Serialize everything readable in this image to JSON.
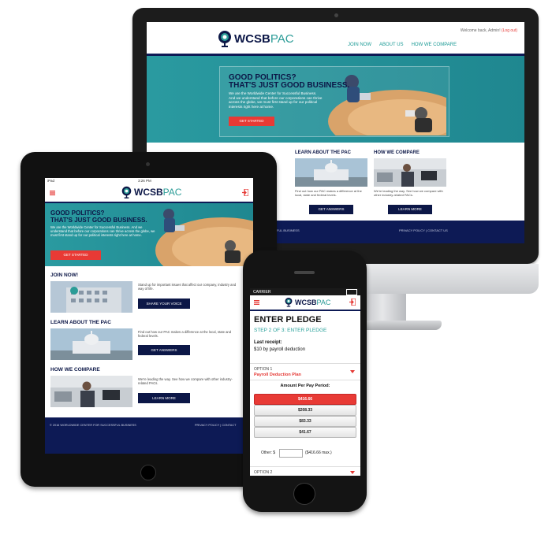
{
  "desktop": {
    "welcome_prefix": "Welcome back, Admin!",
    "logout": "(Log out)",
    "logo": {
      "bold": "WCSB",
      "light": "PAC"
    },
    "nav": [
      "JOIN NOW",
      "ABOUT US",
      "HOW WE COMPARE"
    ],
    "hero": {
      "title": "GOOD POLITICS?\nTHAT'S JUST GOOD BUSINESS.",
      "text": "We are the Worldwide Center for Successful Business. And we understand that before our corporations can thrive across the globe, we must first stand up for our political interests right here at home.",
      "cta": "GET STARTED"
    },
    "columns": [
      {
        "title": "LEARN ABOUT THE PAC",
        "text": "Find out how our PAC makes a difference at the local, state and federal levels.",
        "button": "GET ANSWERS"
      },
      {
        "title": "HOW WE COMPARE",
        "text": "We're leading the way. See how we compare with other industry-related PACs.",
        "button": "LEARN MORE"
      }
    ],
    "footer_left": "…CESSFUL BUSINESS",
    "footer_right": "PRIVACY POLICY | CONTACT US"
  },
  "tablet": {
    "status_left": "iPad",
    "status_center": "3:26 PM",
    "logo": {
      "bold": "WCSB",
      "light": "PAC"
    },
    "hero": {
      "title": "GOOD POLITICS?\nTHAT'S JUST GOOD BUSINESS.",
      "text": "We are the Worldwide Center for Successful Business. And we understand that before our corporations can thrive across the globe, we must first stand up for our political interests right here at home.",
      "cta": "GET STARTED"
    },
    "sections": [
      {
        "title": "JOIN NOW!",
        "text": "Stand up for important issues that affect our company, industry and way of life.",
        "button": "SHARE YOUR VOICE"
      },
      {
        "title": "LEARN ABOUT THE PAC",
        "text": "Find out how our PAC makes a difference at the local, state and federal levels.",
        "button": "GET ANSWERS"
      },
      {
        "title": "HOW WE COMPARE",
        "text": "We're leading the way. See how we compare with other industry-related PACs.",
        "button": "LEARN MORE"
      }
    ],
    "footer_left": "© 2016 WORLDWIDE CENTER FOR SUCCESSFUL BUSINESS",
    "footer_right": "PRIVACY POLICY | CONTACT"
  },
  "phone": {
    "carrier": "CARRIER",
    "logo": {
      "bold": "WCSB",
      "light": "PAC"
    },
    "title": "ENTER PLEDGE",
    "step": "STEP 2 OF 3: ENTER PLEDGE",
    "receipt_label": "Last receipt:",
    "receipt_value": "$10 by payroll deduction",
    "option_label": "OPTION 1",
    "plan": "Payroll Deduction Plan",
    "amount_label": "Amount Per Pay Period:",
    "amounts": [
      "$416.66",
      "$208.33",
      "$83.33",
      "$41.67"
    ],
    "other_label": "Other:  $",
    "other_max": "($416.66 max.)",
    "option2_label": "OPTION 2"
  },
  "colors": {
    "navy": "#0d1a55",
    "teal": "#1f8790",
    "red": "#e83a35",
    "accent_teal": "#27a09a"
  }
}
